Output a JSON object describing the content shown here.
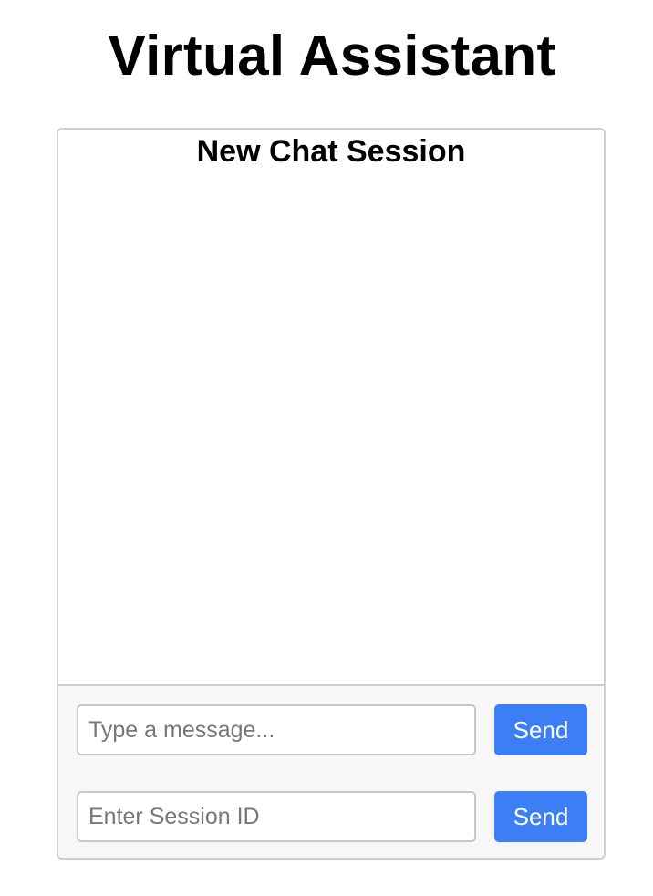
{
  "page": {
    "title": "Virtual Assistant"
  },
  "chat": {
    "session_title": "New Chat Session",
    "messages": []
  },
  "message_input": {
    "placeholder": "Type a message...",
    "value": "",
    "send_label": "Send"
  },
  "session_input": {
    "placeholder": "Enter Session ID",
    "value": "",
    "send_label": "Send"
  },
  "colors": {
    "accent": "#3b7ef6",
    "border": "#cfcfcf",
    "input_area_background": "#f7f7f7"
  }
}
